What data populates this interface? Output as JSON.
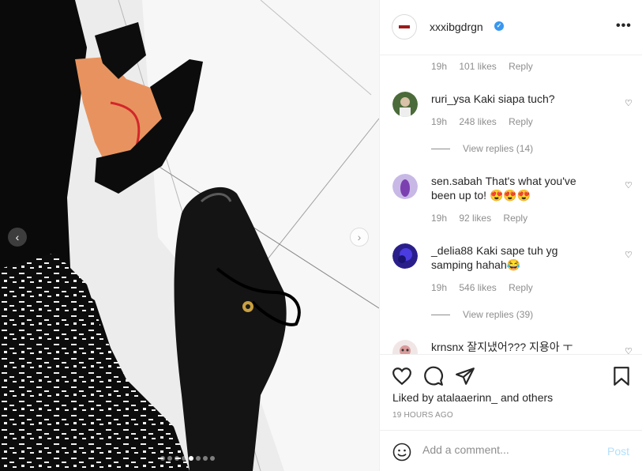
{
  "photo": {
    "carousel_dots": 7,
    "active_dot": 4
  },
  "header": {
    "username": "xxxibgdrgn",
    "verified": true,
    "more_label": "•••"
  },
  "top_meta": {
    "time": "19h",
    "likes": "101 likes",
    "reply": "Reply"
  },
  "comments": [
    {
      "user": "ruri_ysa",
      "text": "Kaki siapa tuch?",
      "time": "19h",
      "likes": "248 likes",
      "reply": "Reply",
      "view_replies": "View replies (14)"
    },
    {
      "user": "sen.sabah",
      "text": "That's what you've been up to! 😍😍😍",
      "time": "19h",
      "likes": "92 likes",
      "reply": "Reply",
      "view_replies": ""
    },
    {
      "user": "_delia88",
      "text": "Kaki sape tuh yg samping hahah😂",
      "time": "19h",
      "likes": "546 likes",
      "reply": "Reply",
      "view_replies": "View replies (39)"
    },
    {
      "user": "krnsnx",
      "text": "잘지냈어??? 지용아 ㅜ",
      "time": "",
      "likes": "",
      "reply": "",
      "view_replies": ""
    }
  ],
  "actions": {
    "liked_by": "Liked by atalaaerinn_ and others",
    "timestamp": "19 HOURS AGO"
  },
  "add_comment": {
    "placeholder": "Add a comment...",
    "post_label": "Post"
  },
  "icons": {
    "like": "heart-icon",
    "comment": "comment-icon",
    "share": "share-icon",
    "save": "bookmark-icon",
    "emoji": "emoji-icon",
    "prev": "chevron-left-icon",
    "next": "chevron-right-icon"
  },
  "colors": {
    "verified": "#3897f0",
    "post_disabled": "#b2dffc",
    "muted_text": "#8e8e8e"
  }
}
